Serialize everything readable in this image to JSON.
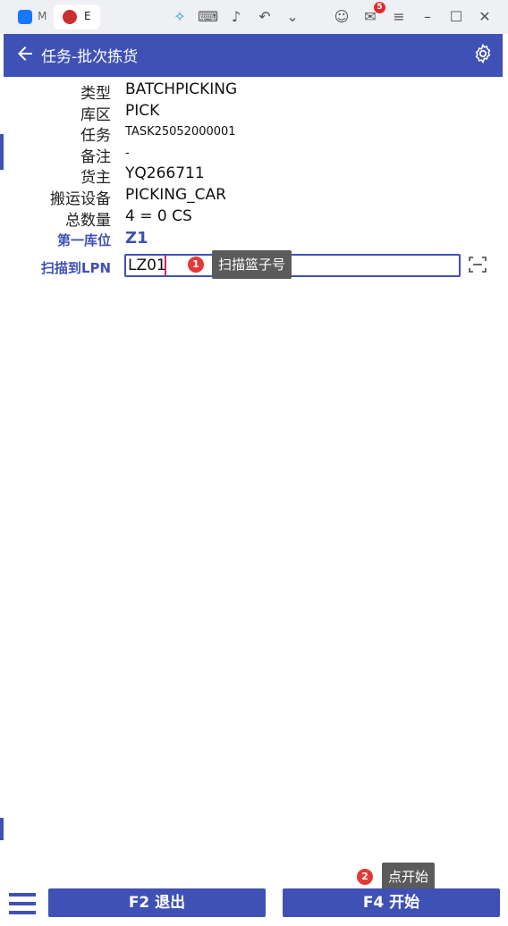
{
  "browser": {
    "tabs": [
      {
        "label": "M"
      },
      {
        "label": "E"
      }
    ],
    "icons": [
      "butterfly-icon",
      "keyboard-icon",
      "volume-icon",
      "undo-icon",
      "chevron-down-icon",
      "user-icon",
      "mail-icon",
      "menu-icon",
      "minimize-icon",
      "maximize-icon",
      "close-icon"
    ],
    "mail_badge": "5"
  },
  "header": {
    "title": "任务-批次拣货"
  },
  "fields": [
    {
      "label": "类型",
      "value": "BATCHPICKING"
    },
    {
      "label": "库区",
      "value": "PICK"
    },
    {
      "label": "任务",
      "value": "TASK25052000001"
    },
    {
      "label": "备注",
      "value": "-"
    },
    {
      "label": "货主",
      "value": "YQ266711"
    },
    {
      "label": "搬运设备",
      "value": "PICKING_CAR"
    },
    {
      "label": "总数量",
      "value": "4 = 0 CS"
    }
  ],
  "first_location": {
    "label": "第一库位",
    "value": "Z1"
  },
  "scan": {
    "label": "扫描到LPN",
    "value": "LZ01"
  },
  "tips": [
    {
      "num": "1",
      "text": "扫描篮子号"
    },
    {
      "num": "2",
      "text": "点开始"
    }
  ],
  "footer": {
    "exit_label": "F2 退出",
    "start_label": "F4 开始"
  },
  "colors": {
    "primary": "#3f51b5",
    "badge": "#e53935"
  }
}
